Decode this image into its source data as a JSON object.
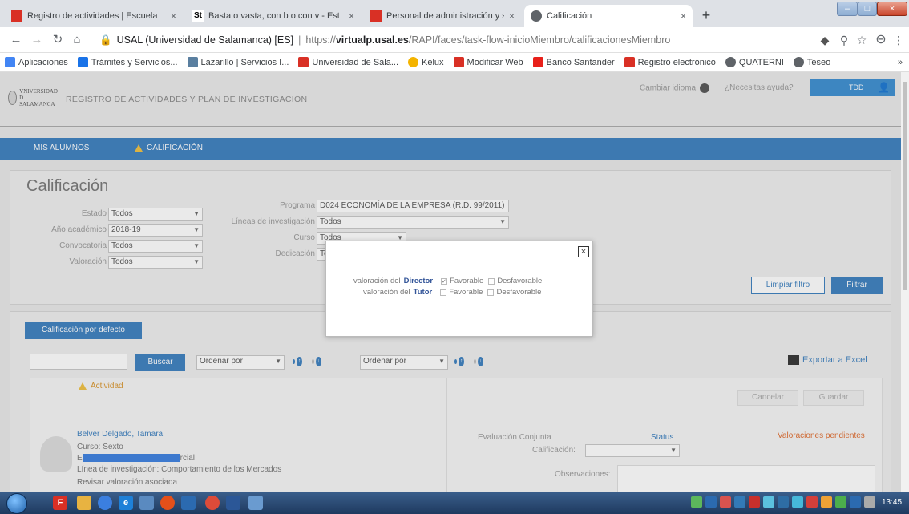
{
  "browser": {
    "tabs": [
      {
        "title": "Registro de actividades | Escuela",
        "close": "×"
      },
      {
        "title": "Basta o vasta, con b o con v - Est",
        "close": "×"
      },
      {
        "title": "Personal de administración y serv",
        "close": "×"
      },
      {
        "title": "Calificación",
        "close": "×"
      }
    ],
    "new_tab": "+",
    "address": {
      "host": "USAL (Universidad de Salamanca) [ES]",
      "scheme": "https://",
      "domain_bold": "virtualp.usal.es",
      "path": "/RAPI/faces/task-flow-inicioMiembro/calificacionesMiembro"
    },
    "bookmarks": [
      {
        "label": "Aplicaciones",
        "color": "#4285f4"
      },
      {
        "label": "Trámites y Servicios...",
        "color": "#1a73e8"
      },
      {
        "label": "Lazarillo | Servicios I...",
        "color": "#5a7fa0"
      },
      {
        "label": "Universidad de Sala...",
        "color": "#d93025"
      },
      {
        "label": "Kelux",
        "color": "#f4b400"
      },
      {
        "label": "Modificar Web",
        "color": "#d93025"
      },
      {
        "label": "Banco Santander",
        "color": "#e8201a"
      },
      {
        "label": "Registro electrónico",
        "color": "#d93025"
      },
      {
        "label": "QUATERNI",
        "color": "#5f6368"
      },
      {
        "label": "Teseo",
        "color": "#5f6368"
      }
    ],
    "bookmarks_more": "»"
  },
  "app": {
    "logo_line1": "VNIVERSIDAD",
    "logo_line2": "D SALAMANCA",
    "title": "REGISTRO DE ACTIVIDADES Y PLAN DE INVESTIGACIÓN",
    "change_lang": "Cambiar idioma",
    "help": "¿Necesitas ayuda?",
    "user_initials": "TDD",
    "nav": {
      "students": "MIS ALUMNOS",
      "grading": "CALIFICACIÓN"
    }
  },
  "filters": {
    "heading": "Calificación",
    "estado": {
      "label": "Estado",
      "value": "Todos"
    },
    "anio": {
      "label": "Año académico",
      "value": "2018-19"
    },
    "convocatoria": {
      "label": "Convocatoria",
      "value": "Todos"
    },
    "valoracion": {
      "label": "Valoración",
      "value": "Todos"
    },
    "programa": {
      "label": "Programa",
      "value": "D024 ECONOMÍA DE LA EMPRESA (R.D. 99/2011)"
    },
    "lineas": {
      "label": "Líneas de investigación",
      "value": "Todos"
    },
    "curso": {
      "label": "Curso",
      "value": "Todos"
    },
    "dedicacion": {
      "label": "Dedicación",
      "value": "To"
    },
    "clear": "Limpiar filtro",
    "apply": "Filtrar"
  },
  "results": {
    "default_grade_btn": "Calificación por defecto",
    "search_btn": "Buscar",
    "order1": "Ordenar por",
    "order2": "Ordenar por",
    "export": "Exportar a Excel",
    "activity_head": "Actividad",
    "cancel": "Cancelar",
    "save": "Guardar",
    "student": {
      "name": "Belver Delgado, Tamara",
      "course": "Curso: Sexto",
      "prefix": "E",
      "suffix": "rcial",
      "line": "Línea de investigación: Comportamiento de los Mercados",
      "partial": "Revisar valoración asociada"
    },
    "joint_eval": "Evaluación Conjunta",
    "status": "Status",
    "pending": "Valoraciones pendientes",
    "grade_label": "Calificación:",
    "obs_label": "Observaciones:"
  },
  "modal": {
    "close": "×",
    "row1": {
      "prefix": "valoración del",
      "role": "Director",
      "fav": "Favorable",
      "desfav": "Desfavorable"
    },
    "row2": {
      "prefix": "valoración del",
      "role": "Tutor",
      "fav": "Favorable",
      "desfav": "Desfavorable"
    }
  },
  "taskbar": {
    "time": "13:45"
  }
}
